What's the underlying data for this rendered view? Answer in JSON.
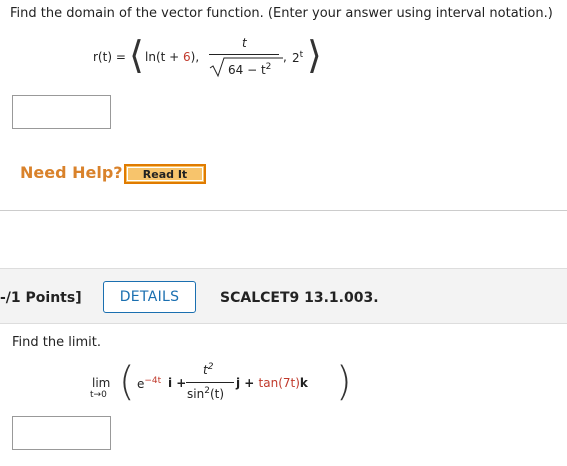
{
  "question1": {
    "prompt": "Find the domain of the vector function. (Enter your answer using interval notation.)",
    "formula": {
      "lhs": "r(t) =",
      "ln_prefix": "ln(t + ",
      "ln_red": "6",
      "ln_suffix": "),",
      "frac_num": "t",
      "sqrt_content_red": "64",
      "sqrt_content_rest": " − t",
      "sqrt_sup": "2",
      "comma": ",",
      "exp_base": "2",
      "exp_sup": "t"
    },
    "answer_value": ""
  },
  "help": {
    "need_help_label": "Need Help?",
    "read_it_label": "Read It"
  },
  "question2": {
    "points_label": "-/1 Points]",
    "details_label": "DETAILS",
    "assignment_id": "SCALCET9 13.1.003.",
    "prompt": "Find the limit.",
    "formula": {
      "lim": "lim",
      "lim_sub": "t→0",
      "e": "e",
      "e_sup_red": "−4t",
      "i_term": "i +",
      "frac_num": "t",
      "frac_num_sup": "2",
      "frac_den": "sin",
      "frac_den_sup": "2",
      "frac_den_arg": "(t)",
      "j_term": "j + ",
      "tan_red": "tan(7t)",
      "k_term": "k"
    },
    "answer_value": ""
  }
}
